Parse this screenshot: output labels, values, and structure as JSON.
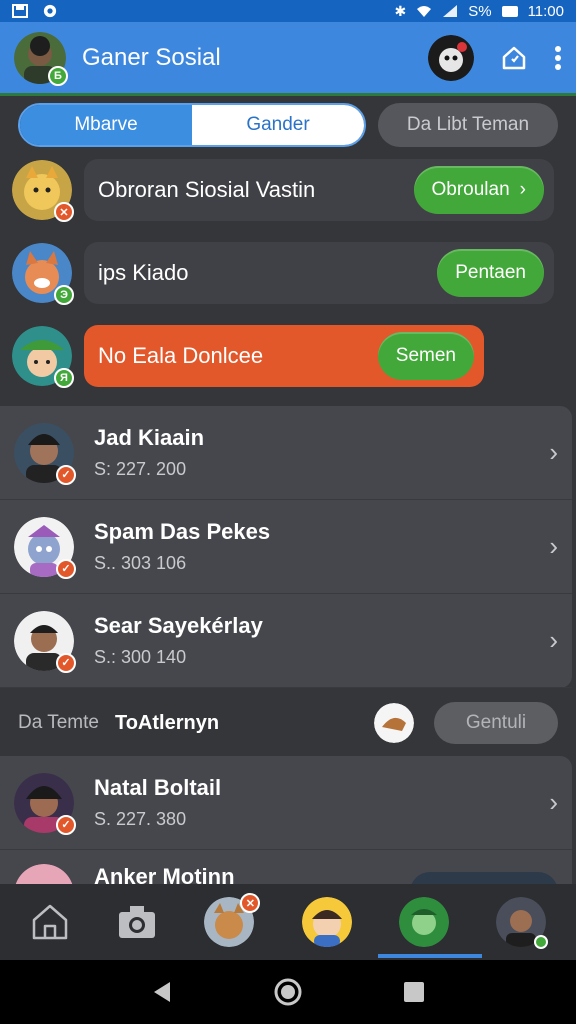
{
  "status_bar": {
    "battery": "S%",
    "time": "11:00"
  },
  "app_bar": {
    "title": "Ganer Sosial",
    "avatar_badge": "Б"
  },
  "tabs": [
    {
      "label": "Mbarve"
    },
    {
      "label": "Gander"
    },
    {
      "label": "Da Libt Teman"
    }
  ],
  "notifications": [
    {
      "text": "Obroran Siosial Vastin",
      "button": "Obroulan",
      "badge": "✕"
    },
    {
      "text": "ips Kiado",
      "button": "Pentaen",
      "badge": "Э"
    },
    {
      "text": "No Eala Donlcee",
      "button": "Semen",
      "badge": "Я"
    }
  ],
  "contacts": [
    {
      "name": "Jad Kiaain",
      "sub": "S:  227. 200"
    },
    {
      "name": "Spam Das Pekes",
      "sub": "S..  303 106"
    },
    {
      "name": "Sear Sayekérlay",
      "sub": "S.: 300 140"
    }
  ],
  "section": {
    "label": "Da Temte",
    "value": "ToAtlernyn",
    "button": "Gentuli"
  },
  "contacts2": [
    {
      "name": "Natal Boltail",
      "sub": "S.  227. 380"
    },
    {
      "name": "Anker Motinn",
      "sub": ""
    }
  ],
  "colors": {
    "accent": "#3d88de",
    "green": "#43a83a",
    "orange": "#e3582b"
  }
}
